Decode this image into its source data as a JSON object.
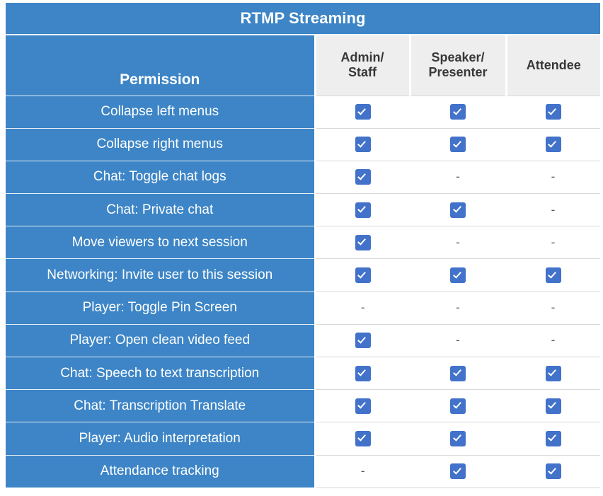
{
  "table": {
    "title": "RTMP Streaming",
    "columns": {
      "permission_header": "Permission",
      "roles": [
        {
          "id": "admin-staff",
          "lines": [
            "Admin/",
            "Staff"
          ]
        },
        {
          "id": "speaker-presenter",
          "lines": [
            "Speaker/",
            "Presenter"
          ]
        },
        {
          "id": "attendee",
          "lines": [
            "Attendee"
          ]
        }
      ]
    },
    "glyphs": {
      "checked": "checkmark-icon",
      "unchecked": "-"
    },
    "colors": {
      "header_blue": "#3d85c6",
      "header_gray": "#eeeeee",
      "checkbox_blue": "#4272c9",
      "row_text": "#ffffff",
      "role_text": "#383838",
      "dash": "#555555",
      "grid_line": "#d9d9d9"
    },
    "rows": [
      {
        "label": "Collapse left menus",
        "values": [
          "check",
          "check",
          "check"
        ]
      },
      {
        "label": "Collapse right menus",
        "values": [
          "check",
          "check",
          "check"
        ]
      },
      {
        "label": "Chat: Toggle chat logs",
        "values": [
          "check",
          "dash",
          "dash"
        ]
      },
      {
        "label": "Chat: Private chat",
        "values": [
          "check",
          "check",
          "dash"
        ]
      },
      {
        "label": "Move viewers to next session",
        "values": [
          "check",
          "dash",
          "dash"
        ]
      },
      {
        "label": "Networking: Invite user to this session",
        "values": [
          "check",
          "check",
          "check"
        ]
      },
      {
        "label": "Player: Toggle Pin Screen",
        "values": [
          "dash",
          "dash",
          "dash"
        ]
      },
      {
        "label": "Player: Open clean video feed",
        "values": [
          "check",
          "dash",
          "dash"
        ]
      },
      {
        "label": "Chat: Speech to text transcription",
        "values": [
          "check",
          "check",
          "check"
        ]
      },
      {
        "label": "Chat: Transcription Translate",
        "values": [
          "check",
          "check",
          "check"
        ]
      },
      {
        "label": "Player: Audio interpretation",
        "values": [
          "check",
          "check",
          "check"
        ]
      },
      {
        "label": "Attendance tracking",
        "values": [
          "dash",
          "check",
          "check"
        ]
      }
    ]
  }
}
